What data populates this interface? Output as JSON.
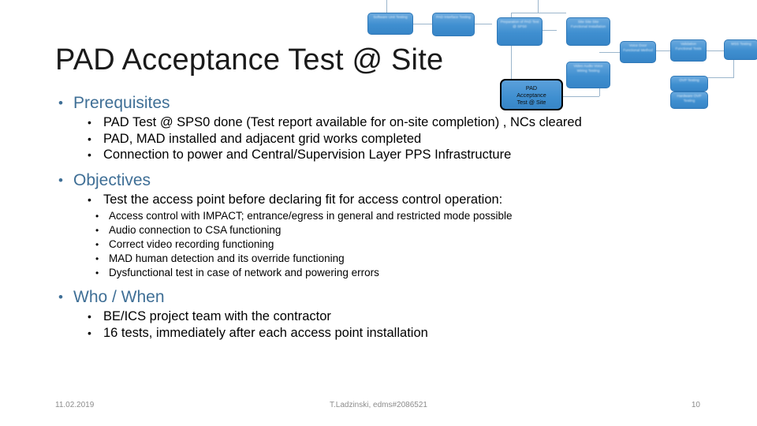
{
  "slide": {
    "title": "PAD Acceptance Test @ Site",
    "accent_color": "#3f6f96",
    "body_color": "#000000",
    "background_color": "#ffffff"
  },
  "sections": [
    {
      "heading": "Prerequisites",
      "bullets": [
        "PAD Test @ SPS0 done (Test report available for on-site completion) , NCs cleared",
        "PAD, MAD installed and adjacent grid works completed",
        "Connection to power and Central/Supervision Layer PPS Infrastructure"
      ]
    },
    {
      "heading": "Objectives",
      "bullets": [
        "Test the access point before declaring fit for access control operation:"
      ],
      "sub_bullets": [
        "Access control with IMPACT;  entrance/egress in general and restricted mode possible",
        "Audio connection to CSA functioning",
        "Correct video recording functioning",
        "MAD human detection and its override functioning",
        "Dysfunctional test in case of network and powering errors"
      ]
    },
    {
      "heading": "Who / When",
      "bullets": [
        "BE/ICS project team with the contractor",
        "16 tests, immediately after each access point installation"
      ]
    }
  ],
  "diagram": {
    "callout_label": "PAD\nAcceptance\nTest @ Site",
    "box_fill_color": "#3f8fd0",
    "nodes": [
      "Software Unit Testing",
      "PAD Interface Testing",
      "Preparation of PAD Test @ SPS0",
      "Site Site Site Functional Installation",
      "Video Audio Voice Wiring Testing",
      "Voice Door Functional Method",
      "Validation Functional Tests",
      "OVP Testing",
      "Hardware OVP Testing",
      "MSS Testing"
    ]
  },
  "footer": {
    "date": "11.02.2019",
    "author": "T.Ladzinski, edms#2086521",
    "page_number": "10"
  }
}
